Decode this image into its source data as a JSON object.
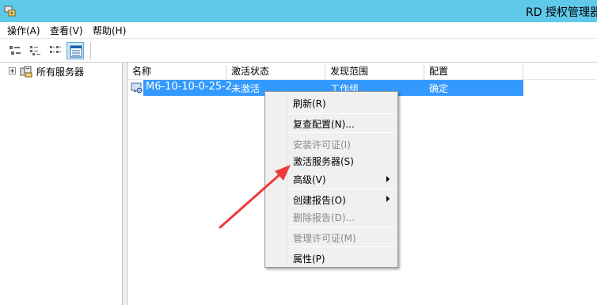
{
  "window": {
    "title": "RD 授权管理器",
    "title_visible": "RD 授权管理器"
  },
  "menubar": {
    "items": [
      {
        "label": "操作(A)"
      },
      {
        "label": "查看(V)"
      },
      {
        "label": "帮助(H)"
      }
    ]
  },
  "toolbar": {
    "buttons": [
      {
        "icon": "large-icons-view-icon"
      },
      {
        "icon": "small-icons-view-icon"
      },
      {
        "icon": "list-view-icon"
      },
      {
        "icon": "details-view-icon",
        "active": true
      }
    ]
  },
  "tree": {
    "root_label": "所有服务器"
  },
  "list": {
    "columns": [
      "名称",
      "激活状态",
      "发现范围",
      "配置"
    ],
    "rows": [
      {
        "name": "M6-10-10-0-25-2",
        "status": "未激活",
        "scope": "工作组",
        "config": "确定",
        "selected": true
      }
    ]
  },
  "context_menu": {
    "items": [
      {
        "label": "刷新(R)",
        "disabled": false
      },
      {
        "label": "复查配置(N)...",
        "disabled": false
      },
      {
        "label": "安装许可证(I)",
        "disabled": true
      },
      {
        "label": "激活服务器(S)",
        "disabled": false
      },
      {
        "label": "高级(V)",
        "disabled": false,
        "submenu": true
      },
      {
        "label": "创建报告(O)",
        "disabled": false,
        "submenu": true
      },
      {
        "label": "删除报告(D)...",
        "disabled": true
      },
      {
        "label": "管理许可证(M)",
        "disabled": true
      },
      {
        "label": "属性(P)",
        "disabled": false
      }
    ]
  },
  "colors": {
    "titlebar": "#5fc9ea",
    "selection": "#3399ff",
    "annotation_arrow": "#f0393b"
  }
}
